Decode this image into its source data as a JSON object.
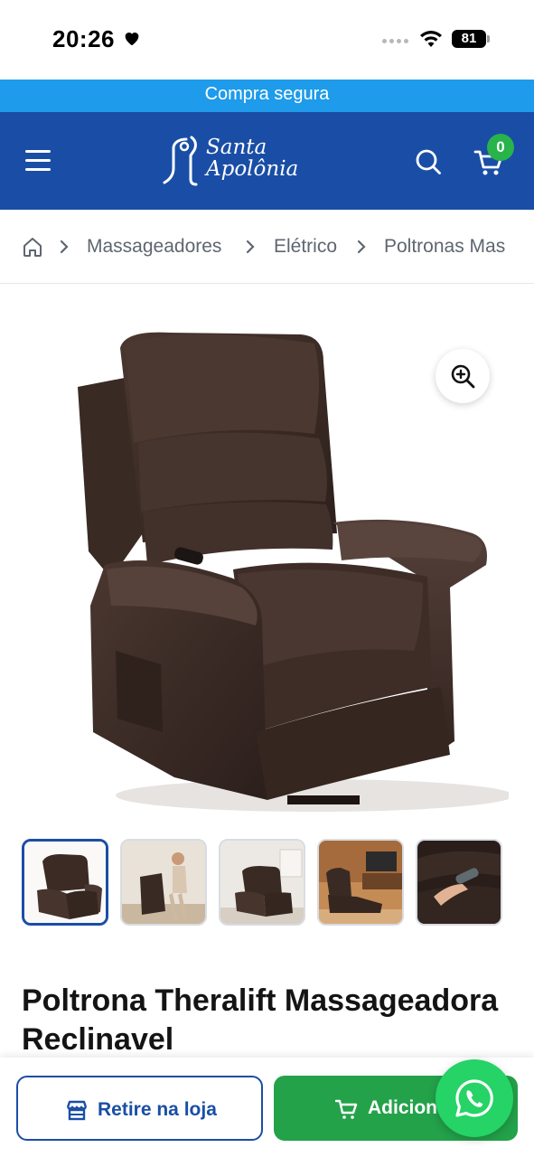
{
  "status_bar": {
    "time": "20:26",
    "battery": "81",
    "icons": [
      "heart-icon",
      "cellular-dots-icon",
      "wifi-icon",
      "battery-icon"
    ]
  },
  "announcement": {
    "text": "Compra segura",
    "background": "#1e9bea"
  },
  "header": {
    "background": "#1a4ea6",
    "logo_line1": "Santa",
    "logo_line2": "Apolônia",
    "cart_count": "0",
    "icons": [
      "menu-icon",
      "search-icon",
      "cart-icon"
    ]
  },
  "breadcrumb": {
    "items": [
      "Massageadores",
      "Elétrico",
      "Poltronas Mas"
    ],
    "icons": [
      "home-icon",
      "chevron-right-icon"
    ]
  },
  "gallery": {
    "main_image": "brown-leather-recliner-chair",
    "zoom_icon": "zoom-in-icon",
    "thumbnails": [
      "recliner-front-view",
      "woman-using-lift-recliner",
      "recliner-in-living-room",
      "recliner-reclined-in-living-room",
      "hand-holding-remote-on-armrest"
    ]
  },
  "product": {
    "title": "Poltrona Theralift Massageadora Reclinavel"
  },
  "actions": {
    "pickup_label": "Retire na loja",
    "add_label": "Adicionar",
    "add_color": "#23a24a",
    "whatsapp_color": "#25d366"
  }
}
